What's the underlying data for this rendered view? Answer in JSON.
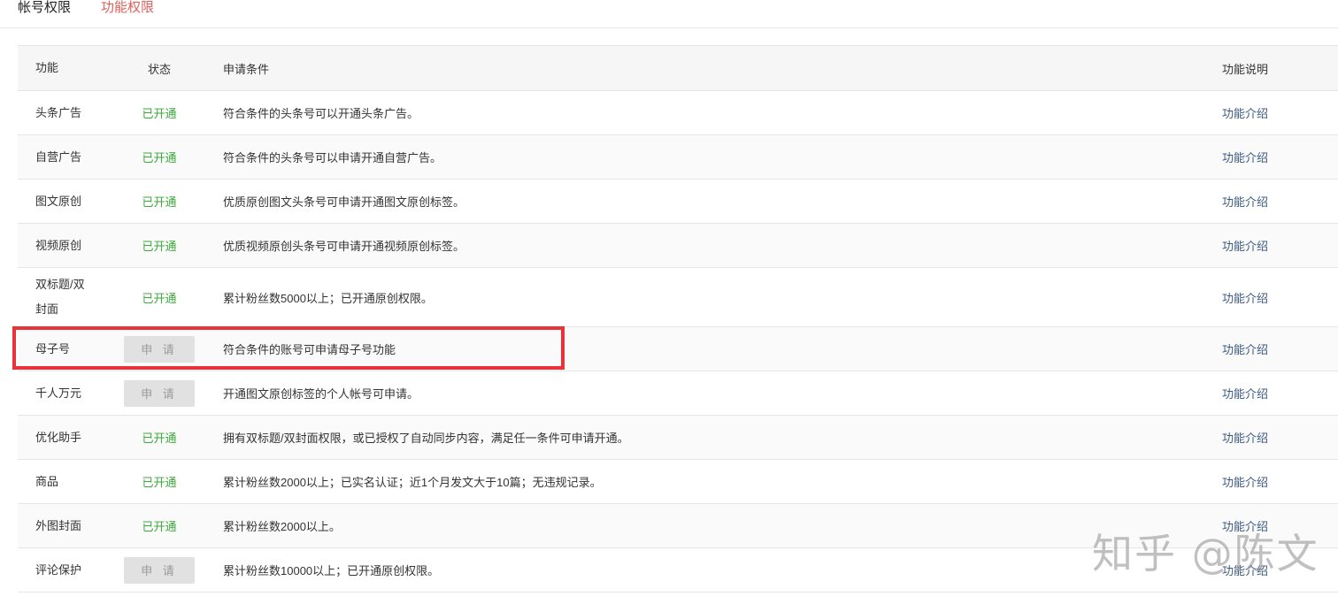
{
  "tabs": [
    {
      "label": "帐号权限",
      "active": false
    },
    {
      "label": "功能权限",
      "active": true
    }
  ],
  "table": {
    "headers": {
      "function": "功能",
      "status": "状态",
      "condition": "申请条件",
      "description": "功能说明"
    },
    "rows": [
      {
        "function": "头条广告",
        "status": "已开通",
        "status_type": "enabled",
        "condition": "符合条件的头条号可以开通头条广告。",
        "description": "功能介绍"
      },
      {
        "function": "自营广告",
        "status": "已开通",
        "status_type": "enabled",
        "condition": "符合条件的头条号可以申请开通自营广告。",
        "description": "功能介绍"
      },
      {
        "function": "图文原创",
        "status": "已开通",
        "status_type": "enabled",
        "condition": "优质原创图文头条号可申请开通图文原创标签。",
        "description": "功能介绍"
      },
      {
        "function": "视频原创",
        "status": "已开通",
        "status_type": "enabled",
        "condition": "优质视频原创头条号可申请开通视频原创标签。",
        "description": "功能介绍"
      },
      {
        "function": "双标题/双封面",
        "status": "已开通",
        "status_type": "enabled",
        "condition": "累计粉丝数5000以上；已开通原创权限。",
        "description": "功能介绍"
      },
      {
        "function": "母子号",
        "status": "申 请",
        "status_type": "apply",
        "condition": "符合条件的账号可申请母子号功能",
        "description": "功能介绍"
      },
      {
        "function": "千人万元",
        "status": "申 请",
        "status_type": "apply",
        "condition": "开通图文原创标签的个人帐号可申请。",
        "description": "功能介绍"
      },
      {
        "function": "优化助手",
        "status": "已开通",
        "status_type": "enabled",
        "condition": "拥有双标题/双封面权限，或已授权了自动同步内容，满足任一条件可申请开通。",
        "description": "功能介绍"
      },
      {
        "function": "商品",
        "status": "已开通",
        "status_type": "enabled",
        "condition": "累计粉丝数2000以上；已实名认证；近1个月发文大于10篇；无违规记录。",
        "description": "功能介绍"
      },
      {
        "function": "外图封面",
        "status": "已开通",
        "status_type": "enabled",
        "condition": "累计粉丝数2000以上。",
        "description": "功能介绍"
      },
      {
        "function": "评论保护",
        "status": "申 请",
        "status_type": "apply",
        "condition": "累计粉丝数10000以上；已开通原创权限。",
        "description": "功能介绍"
      }
    ]
  },
  "watermark": "知乎 @陈文",
  "colors": {
    "enabled": "#3aaa3a",
    "active_tab": "#e0605a",
    "link": "#3b5a80",
    "highlight": "#e8333a"
  }
}
